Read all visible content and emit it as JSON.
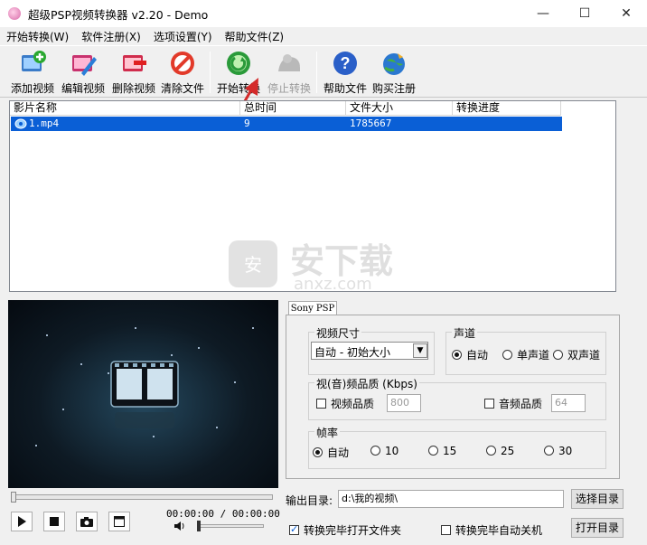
{
  "window": {
    "title": "超级PSP视频转换器 v2.20 - Demo"
  },
  "menu": [
    "开始转换(W)",
    "软件注册(X)",
    "选项设置(Y)",
    "帮助文件(Z)"
  ],
  "toolbar": {
    "add": "添加视频",
    "edit": "编辑视频",
    "delete": "删除视频",
    "clear": "清除文件",
    "start": "开始转换",
    "stop": "停止转换",
    "help": "帮助文件",
    "buy": "购买注册"
  },
  "list": {
    "headers": [
      "影片名称",
      "总时间",
      "文件大小",
      "转换进度"
    ],
    "rows": [
      {
        "name": "1.mp4",
        "time": "9",
        "size": "1785667",
        "progress": ""
      }
    ]
  },
  "watermark": {
    "cn": "安下载",
    "en": "anxz.com"
  },
  "player": {
    "time": "00:00:00 / 00:00:00"
  },
  "settings": {
    "tab": "Sony PSP",
    "size_group": "视频尺寸",
    "size_value": "自动 - 初始大小",
    "audio_group": "声道",
    "audio_options": [
      "自动",
      "单声道",
      "双声道"
    ],
    "quality_group": "视(音)频品质 (Kbps)",
    "video_quality_label": "视频品质",
    "video_quality_value": "800",
    "audio_quality_label": "音频品质",
    "audio_quality_value": "64",
    "fps_group": "帧率",
    "fps_options": [
      "自动",
      "10",
      "15",
      "25",
      "30"
    ]
  },
  "output": {
    "label": "输出目录:",
    "path": "d:\\我的视频\\",
    "choose": "选择目录",
    "open": "打开目录",
    "open_after": "转换完毕打开文件夹",
    "shutdown_after": "转换完毕自动关机"
  }
}
